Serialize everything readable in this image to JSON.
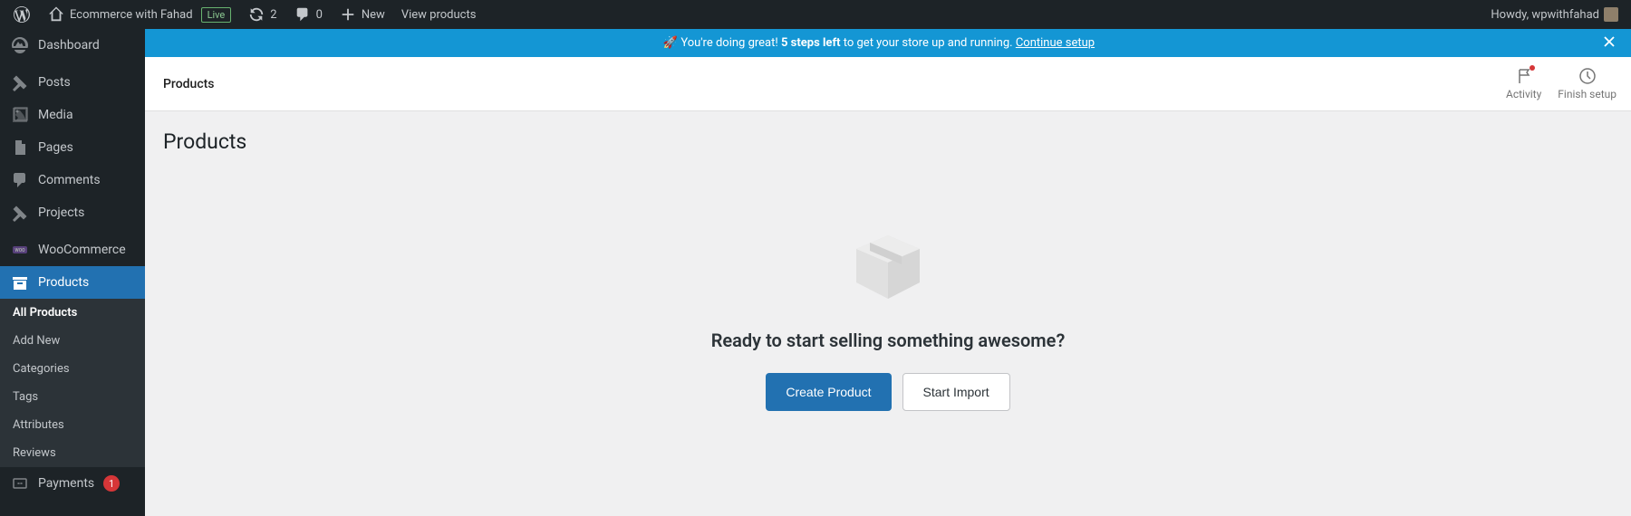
{
  "adminBar": {
    "siteName": "Ecommerce with Fahad",
    "liveBadge": "Live",
    "refreshCount": "2",
    "commentCount": "0",
    "newLabel": "New",
    "viewProductsLabel": "View products",
    "howdyText": "Howdy, wpwithfahad"
  },
  "sidebar": {
    "dashboard": "Dashboard",
    "posts": "Posts",
    "media": "Media",
    "pages": "Pages",
    "comments": "Comments",
    "projects": "Projects",
    "woocommerce": "WooCommerce",
    "products": "Products",
    "payments": "Payments",
    "paymentsBadge": "1"
  },
  "submenu": {
    "allProducts": "All Products",
    "addNew": "Add New",
    "categories": "Categories",
    "tags": "Tags",
    "attributes": "Attributes",
    "reviews": "Reviews"
  },
  "notice": {
    "emoji": "🚀",
    "prefix": "You're doing great!",
    "bold": "5 steps left",
    "suffix": "to get your store up and running.",
    "link": "Continue setup"
  },
  "header": {
    "title": "Products",
    "activity": "Activity",
    "finishSetup": "Finish setup"
  },
  "body": {
    "pageTitle": "Products",
    "emptyHeading": "Ready to start selling something awesome?",
    "createBtn": "Create Product",
    "importBtn": "Start Import"
  }
}
